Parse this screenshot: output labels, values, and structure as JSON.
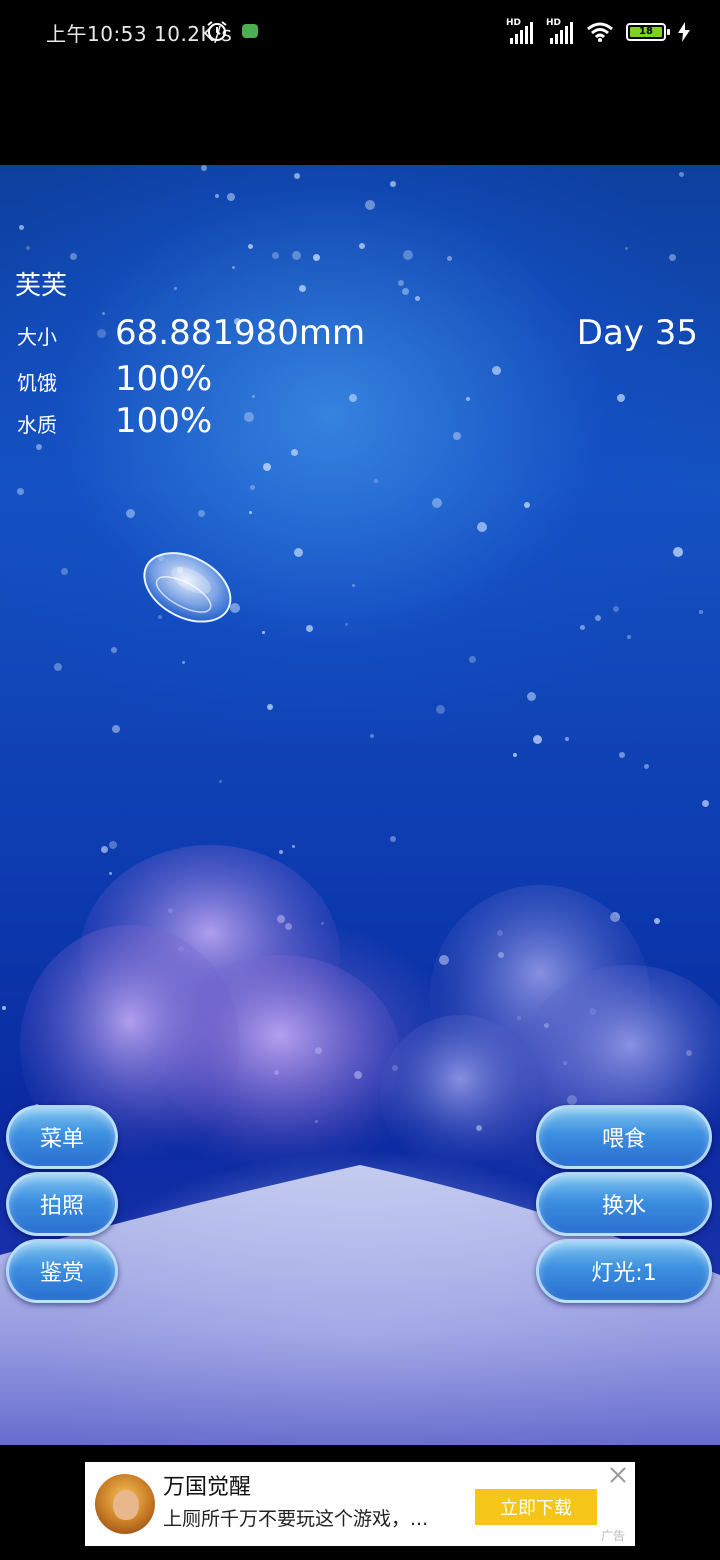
{
  "status_bar": {
    "time_speed": "上午10:53 10.2K/s",
    "battery_level": "18",
    "icons": [
      "alarm-icon",
      "app-notification-icon",
      "hd-signal-icon",
      "hd-signal-icon",
      "wifi-icon",
      "battery-icon",
      "charging-icon"
    ]
  },
  "hud": {
    "pet_name": "芙芙",
    "size_label": "大小",
    "size_value": "68.881980mm",
    "hunger_label": "饥饿",
    "hunger_value": "100%",
    "water_label": "水质",
    "water_value": "100%",
    "day": "Day 35"
  },
  "buttons": {
    "menu": "菜单",
    "photo": "拍照",
    "gallery": "鉴赏",
    "feed": "喂食",
    "change_water": "换水",
    "light": "灯光:1"
  },
  "ad": {
    "title": "万国觉醒",
    "description": "上厕所千万不要玩这个游戏，...",
    "cta": "立即下载",
    "tag": "广告"
  },
  "colors": {
    "button_blue": "#3c8fe0",
    "ad_cta": "#f5c518",
    "battery_green": "#7ed321"
  }
}
